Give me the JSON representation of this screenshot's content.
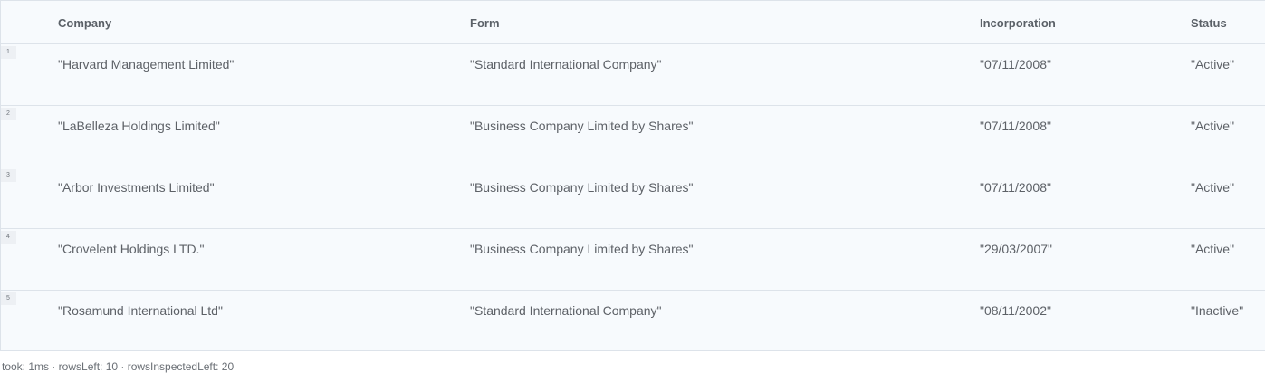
{
  "table": {
    "columns": [
      "Company",
      "Form",
      "Incorporation",
      "Status"
    ],
    "rows": [
      {
        "num": "1",
        "company": "\"Harvard Management Limited\"",
        "form": "\"Standard International Company\"",
        "incorporation": "\"07/11/2008\"",
        "status": "\"Active\""
      },
      {
        "num": "2",
        "company": "\"LaBelleza Holdings Limited\"",
        "form": "\"Business Company Limited by Shares\"",
        "incorporation": "\"07/11/2008\"",
        "status": "\"Active\""
      },
      {
        "num": "3",
        "company": "\"Arbor Investments Limited\"",
        "form": "\"Business Company Limited by Shares\"",
        "incorporation": "\"07/11/2008\"",
        "status": "\"Active\""
      },
      {
        "num": "4",
        "company": "\"Crovelent Holdings LTD.\"",
        "form": "\"Business Company Limited by Shares\"",
        "incorporation": "\"29/03/2007\"",
        "status": "\"Active\""
      },
      {
        "num": "5",
        "company": "\"Rosamund International Ltd\"",
        "form": "\"Standard International Company\"",
        "incorporation": "\"08/11/2002\"",
        "status": "\"Inactive\""
      }
    ]
  },
  "footer": {
    "text": "took: 1ms · rowsLeft: 10 · rowsInspectedLeft: 20"
  }
}
